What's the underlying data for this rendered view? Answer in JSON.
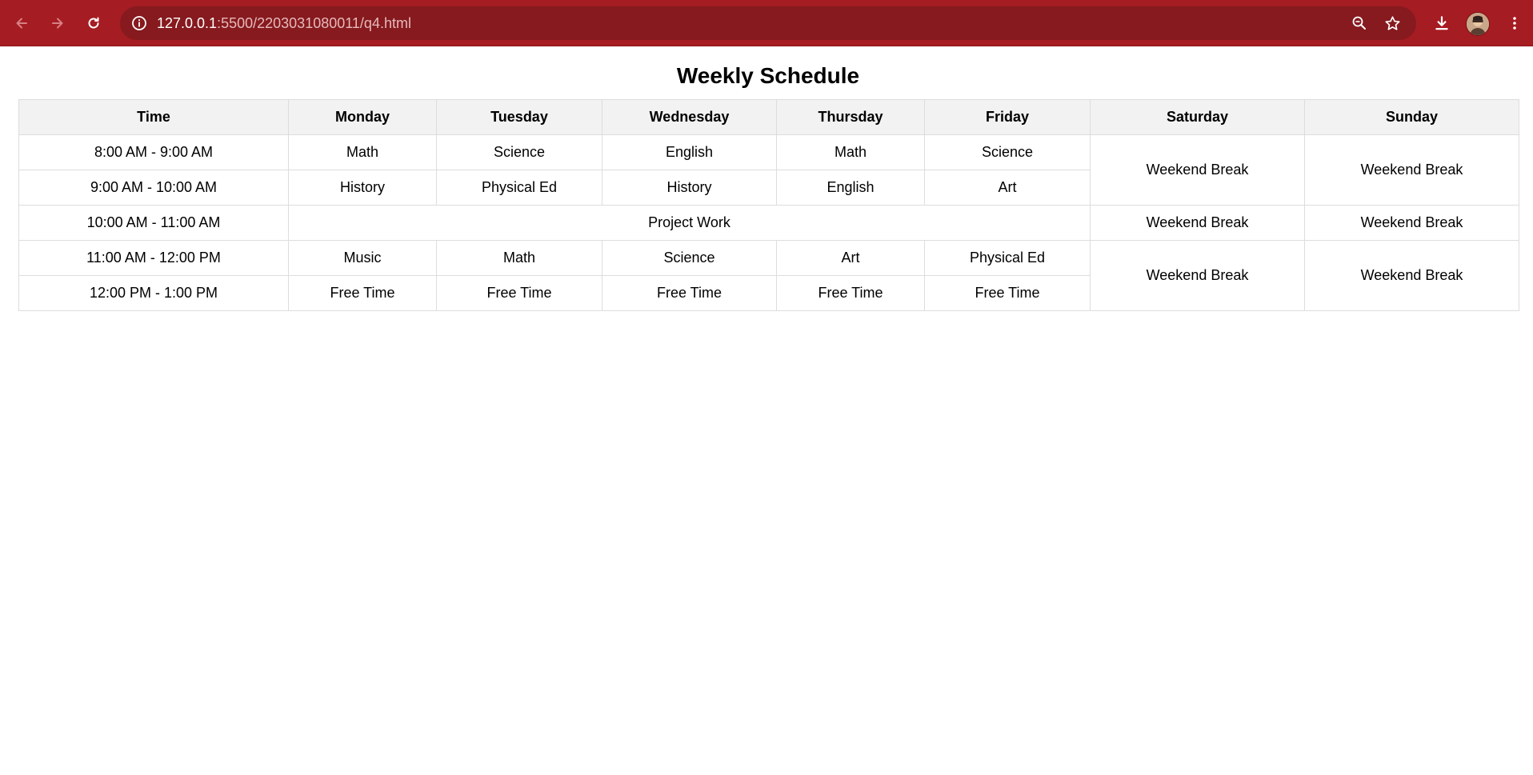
{
  "browser": {
    "url_host": "127.0.0.1",
    "url_rest": ":5500/2203031080011/q4.html",
    "icons": {
      "back": "arrow-left-icon",
      "forward": "arrow-right-icon",
      "reload": "reload-icon",
      "site_info": "info-icon",
      "zoom": "zoom-icon",
      "bookmark": "star-icon",
      "download": "download-icon",
      "profile": "avatar",
      "menu": "kebab-menu-icon"
    },
    "toolbar_color": "#a51c22",
    "omnibox_color": "#861a1e"
  },
  "page": {
    "title": "Weekly Schedule",
    "headers": [
      "Time",
      "Monday",
      "Tuesday",
      "Wednesday",
      "Thursday",
      "Friday",
      "Saturday",
      "Sunday"
    ],
    "rows": [
      {
        "time": "8:00 AM - 9:00 AM",
        "cells": [
          "Math",
          "Science",
          "English",
          "Math",
          "Science"
        ],
        "weekend": [
          "Weekend Break",
          "Weekend Break"
        ]
      },
      {
        "time": "9:00 AM - 10:00 AM",
        "cells": [
          "History",
          "Physical Ed",
          "History",
          "English",
          "Art"
        ]
      },
      {
        "time": "10:00 AM - 11:00 AM",
        "merged": "Project Work",
        "weekend": [
          "Weekend Break",
          "Weekend Break"
        ]
      },
      {
        "time": "11:00 AM - 12:00 PM",
        "cells": [
          "Music",
          "Math",
          "Science",
          "Art",
          "Physical Ed"
        ],
        "weekend": [
          "Weekend Break",
          "Weekend Break"
        ]
      },
      {
        "time": "12:00 PM - 1:00 PM",
        "cells": [
          "Free Time",
          "Free Time",
          "Free Time",
          "Free Time",
          "Free Time"
        ]
      }
    ]
  }
}
